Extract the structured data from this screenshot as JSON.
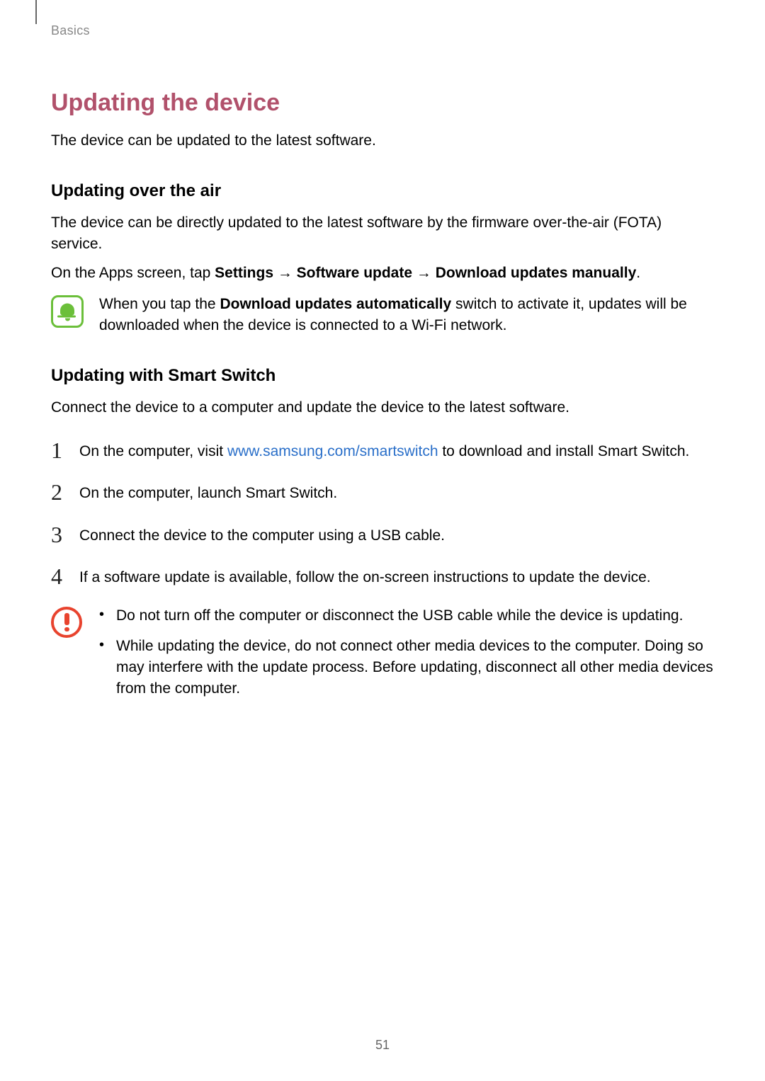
{
  "breadcrumb": "Basics",
  "h1": "Updating the device",
  "intro": "The device can be updated to the latest software.",
  "ota": {
    "heading": "Updating over the air",
    "p1": "The device can be directly updated to the latest software by the firmware over-the-air (FOTA) service.",
    "path_prefix": "On the Apps screen, tap ",
    "path_settings": "Settings",
    "path_arrow": " → ",
    "path_su": "Software update",
    "path_dum": "Download updates manually",
    "path_period": ".",
    "note_prefix": "When you tap the ",
    "note_bold": "Download updates automatically",
    "note_suffix": " switch to activate it, updates will be downloaded when the device is connected to a Wi-Fi network."
  },
  "ss": {
    "heading": "Updating with Smart Switch",
    "intro": "Connect the device to a computer and update the device to the latest software.",
    "steps": {
      "s1_num": "1",
      "s1_pre": "On the computer, visit ",
      "s1_link": "www.samsung.com/smartswitch",
      "s1_post": " to download and install Smart Switch.",
      "s2_num": "2",
      "s2_text": "On the computer, launch Smart Switch.",
      "s3_num": "3",
      "s3_text": "Connect the device to the computer using a USB cable.",
      "s4_num": "4",
      "s4_text": "If a software update is available, follow the on-screen instructions to update the device."
    },
    "caution": {
      "b1": "Do not turn off the computer or disconnect the USB cable while the device is updating.",
      "b2": "While updating the device, do not connect other media devices to the computer. Doing so may interfere with the update process. Before updating, disconnect all other media devices from the computer."
    }
  },
  "page_number": "51"
}
